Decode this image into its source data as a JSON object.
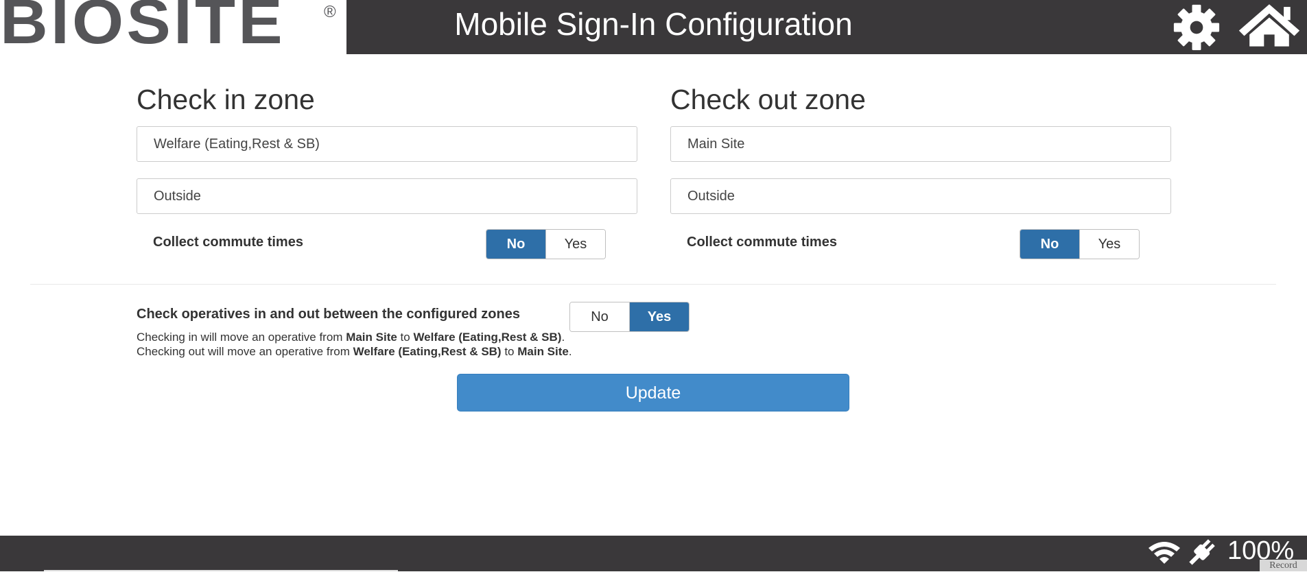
{
  "header": {
    "logo_text": "BIOSITE",
    "logo_reg": "®",
    "title": "Mobile Sign-In Configuration",
    "icons": [
      "gear-icon",
      "home-icon"
    ]
  },
  "check_in": {
    "title": "Check in zone",
    "zone_value": "Welfare (Eating,Rest & SB)",
    "outside_value": "Outside",
    "commute_label": "Collect commute times",
    "toggle": {
      "no": "No",
      "yes": "Yes",
      "selected": "No"
    }
  },
  "check_out": {
    "title": "Check out zone",
    "zone_value": "Main Site",
    "outside_value": "Outside",
    "commute_label": "Collect commute times",
    "toggle": {
      "no": "No",
      "yes": "Yes",
      "selected": "No"
    }
  },
  "between": {
    "label": "Check operatives in and out between the configured zones",
    "toggle": {
      "no": "No",
      "yes": "Yes",
      "selected": "Yes"
    },
    "line1": {
      "prefix": "Checking in will move an operative from ",
      "from": "Main Site",
      "mid": " to ",
      "to": "Welfare (Eating,Rest & SB)",
      "suffix": "."
    },
    "line2": {
      "prefix": "Checking out will move an operative from ",
      "from": "Welfare (Eating,Rest & SB)",
      "mid": " to ",
      "to": "Main Site",
      "suffix": "."
    }
  },
  "update_label": "Update",
  "status_bar": {
    "battery": "100%",
    "record": "Record",
    "icons": [
      "wifi-icon",
      "power-plug-icon"
    ]
  },
  "colors": {
    "header_bg": "#3a383a",
    "accent": "#2e6fa8",
    "button": "#428bca"
  }
}
